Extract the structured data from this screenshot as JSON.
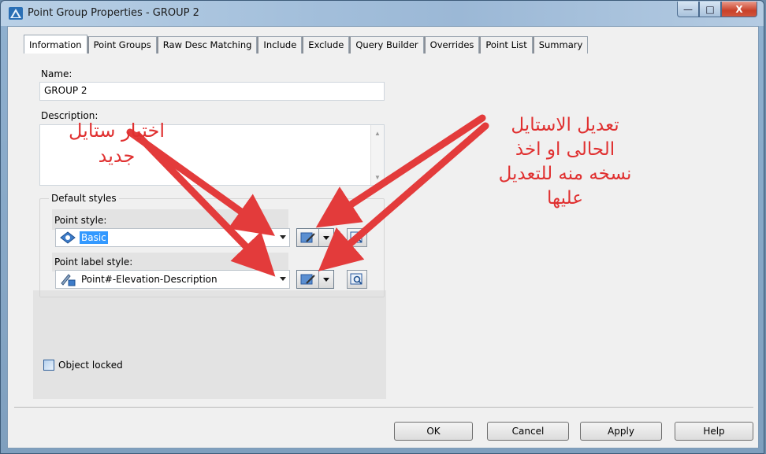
{
  "window": {
    "title": "Point Group Properties - GROUP 2",
    "minimize_icon": "minimize-icon",
    "maximize_icon": "maximize-icon",
    "close_icon": "close-icon",
    "minimize_glyph": "—",
    "maximize_glyph": "□",
    "close_glyph": "X"
  },
  "tabs": [
    {
      "label": "Information",
      "active": true
    },
    {
      "label": "Point Groups"
    },
    {
      "label": "Raw Desc Matching"
    },
    {
      "label": "Include"
    },
    {
      "label": "Exclude"
    },
    {
      "label": "Query Builder"
    },
    {
      "label": "Overrides"
    },
    {
      "label": "Point List"
    },
    {
      "label": "Summary"
    }
  ],
  "information": {
    "name_label": "Name:",
    "name_value": "GROUP 2",
    "description_label": "Description:",
    "description_value": "",
    "default_styles_label": "Default styles",
    "point_style_label": "Point style:",
    "point_style_value": "Basic",
    "point_label_style_label": "Point label style:",
    "point_label_style_value": "Point#-Elevation-Description",
    "object_locked_label": "Object locked",
    "object_locked_checked": false
  },
  "buttons": {
    "ok": "OK",
    "cancel": "Cancel",
    "apply": "Apply",
    "help": "Help"
  },
  "annotations": {
    "left_text_line1": "اختيار ستايل",
    "left_text_line2": "جديد",
    "right_text_line1": "تعديل الاستايل",
    "right_text_line2": "الحالى او اخذ",
    "right_text_line3": "نسخه منه للتعديل",
    "right_text_line4": "عليها",
    "color": "#e03030"
  },
  "colors": {
    "selection": "#3399ff",
    "arrow_red": "#e33b3b"
  }
}
